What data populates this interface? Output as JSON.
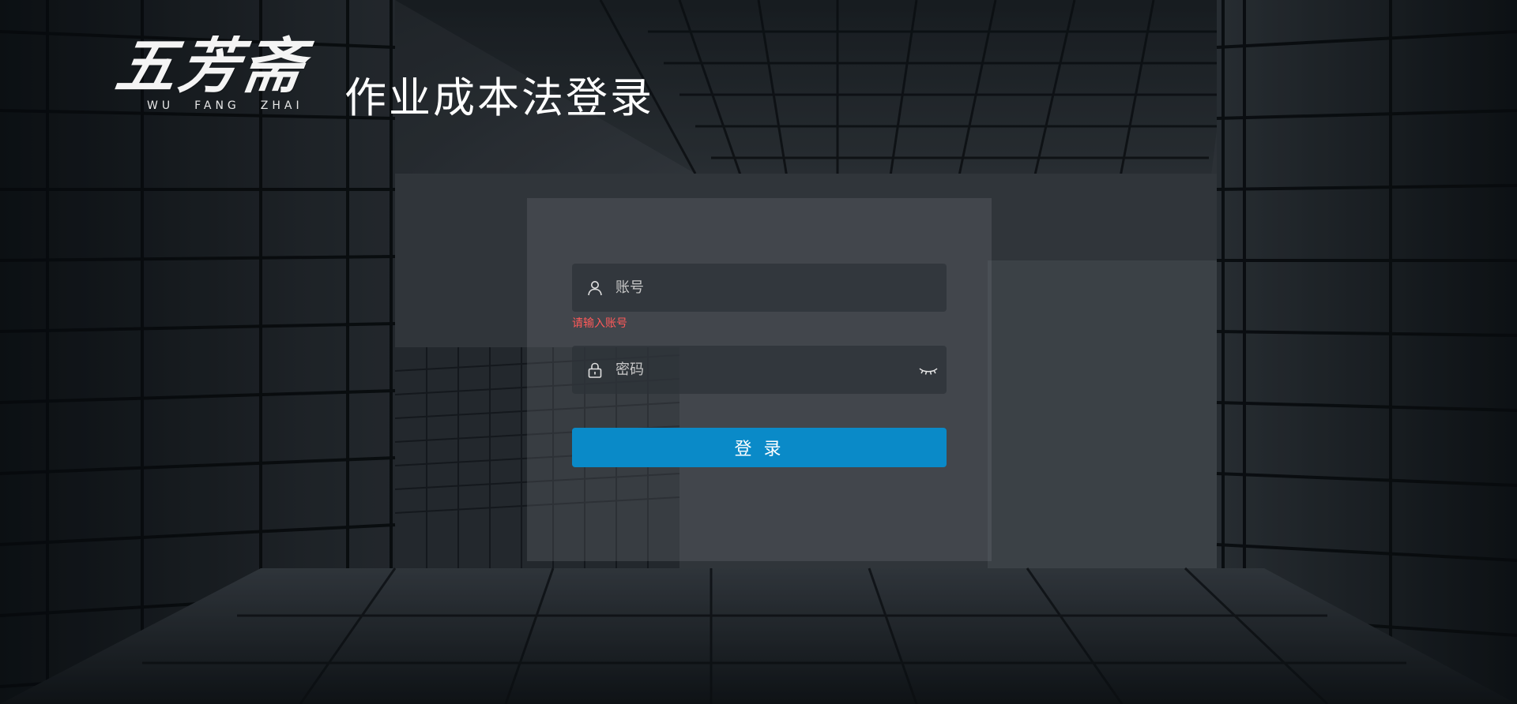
{
  "brand": {
    "logo_chinese": "五芳斋",
    "logo_latin": [
      "WU",
      "FANG",
      "ZHAI"
    ]
  },
  "page_title": "作业成本法登录",
  "login_form": {
    "account_placeholder": "账号",
    "account_value": "",
    "account_error": "请输入账号",
    "password_placeholder": "密码",
    "password_value": "",
    "submit_label": "登 录"
  },
  "icons": {
    "account": "user-icon",
    "password": "lock-icon",
    "toggle_visibility": "eye-closed-icon"
  },
  "colors": {
    "primary_button": "#0a8ac8",
    "error": "#ff5a5a",
    "title_text": "#ffffff"
  }
}
